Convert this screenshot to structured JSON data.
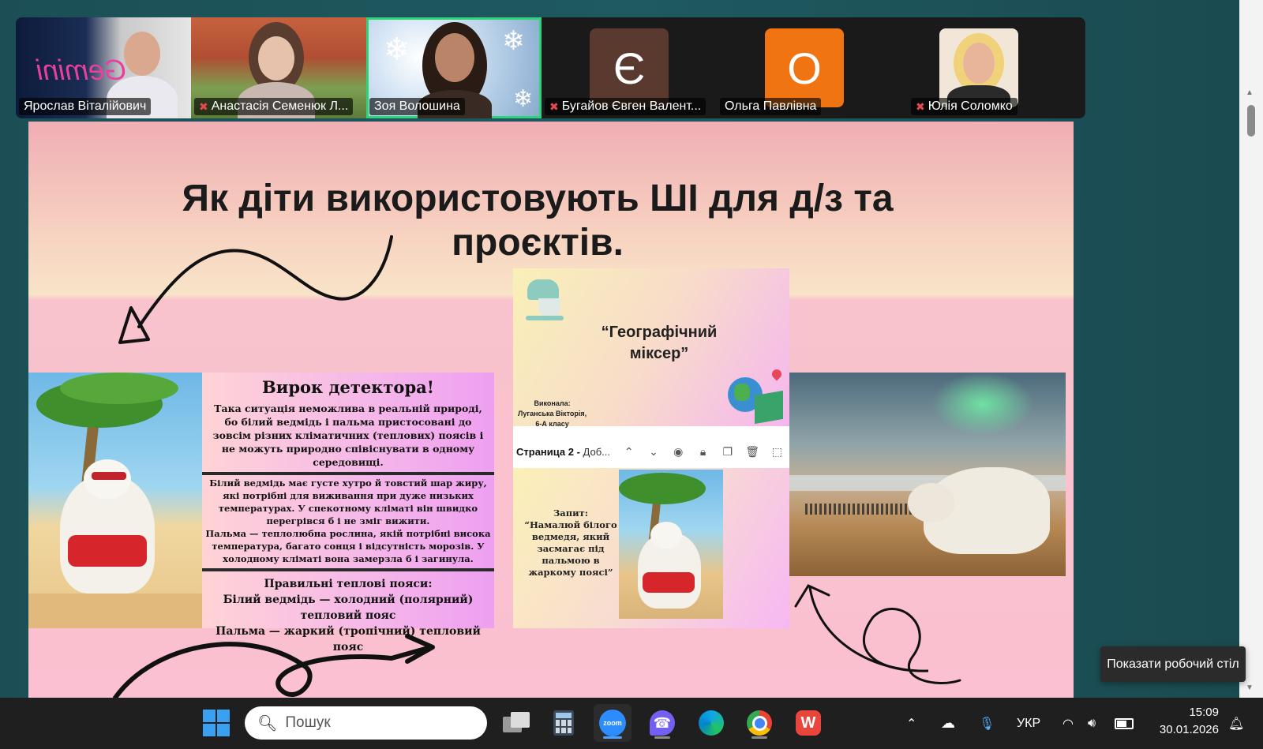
{
  "participants": [
    {
      "name": "Ярослав Віталійович",
      "muted": false,
      "overlay_text": "Gemini"
    },
    {
      "name": "Анастасія Семенюк Л...",
      "muted": true
    },
    {
      "name": "Зоя Волошина",
      "muted": false,
      "active_speaker": true
    },
    {
      "name": "Бугайов Євген Валент...",
      "muted": true,
      "initial": "Є",
      "avatar_color": "#5a3a2e"
    },
    {
      "name": "Ольга Павлівна",
      "muted": false,
      "initial": "О",
      "avatar_color": "#f07412"
    },
    {
      "name": "Юлія Соломко",
      "muted": true
    }
  ],
  "slide": {
    "title_line1": "Як діти використовують ШІ для д/з та",
    "title_line2": "проєктів.",
    "card1": {
      "heading": "Вирок детектора!",
      "para1": "Така ситуація неможлива в реальній природі, бо білий ведмідь і пальма пристосовані до зовсім різних кліматичних (теплових) поясів і не можуть природно співіснувати в одному середовищі.",
      "para2a": "Білий ведмідь має густе хутро й товстий шар жиру, які потрібні для виживання при дуже низьких температурах. У спекотному кліматі він швидко перегрівся б і не зміг вижити.",
      "para2b": "Пальма — теплолюбна рослина, якій потрібні висока температура, багато сонця і відсутність морозів. У холодному кліматі вона замерзла б і загинула.",
      "heading2": "Правильні теплові пояси:",
      "line1": "Білий ведмідь — холодний (полярний) тепловий пояс",
      "line2": "Пальма — жаркий (тропічний) тепловий пояс"
    },
    "card2": {
      "title_line1": "“Географічний",
      "title_line2": "міксер”",
      "by_line1": "Виконала:",
      "by_line2": "Луганська Вікторія,",
      "by_line3": "6-А класу",
      "page_label_bold": "Страница 2 -",
      "page_label_rest": " Доб...",
      "query_line1": "Запит:",
      "query_line2": "“Намалюй білого ведмедя, який засмагає під пальмою в жаркому поясі”"
    }
  },
  "tooltip": "Показати робочий стіл",
  "taskbar": {
    "search_placeholder": "Пошук",
    "language": "УКР",
    "time": "15:09",
    "date": "30.01.2026",
    "zoom_label": "zoom"
  }
}
